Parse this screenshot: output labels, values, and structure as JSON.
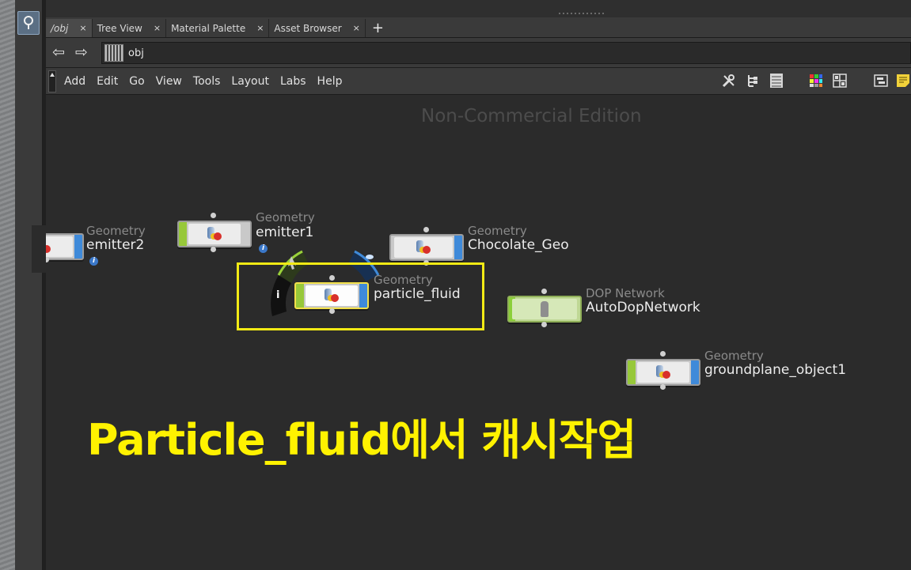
{
  "tabs": [
    {
      "label": "/obj",
      "close": "×",
      "active": true
    },
    {
      "label": "Tree View",
      "close": "×",
      "active": false
    },
    {
      "label": "Material Palette",
      "close": "×",
      "active": false
    },
    {
      "label": "Asset Browser",
      "close": "×",
      "active": false
    }
  ],
  "tab_add": "+",
  "nav": {
    "back": "⇦",
    "forward": "⇨"
  },
  "path": {
    "text": "obj"
  },
  "menu": [
    "Add",
    "Edit",
    "Go",
    "View",
    "Tools",
    "Layout",
    "Labs",
    "Help"
  ],
  "toolbar_icons": [
    "wrench-icon",
    "tree-icon",
    "list-icon",
    "color-grid-icon",
    "grid-layout-icon",
    "network-box-icon",
    "sticky-note-icon"
  ],
  "watermark": "Non-Commercial Edition",
  "nodes": {
    "emitter2": {
      "type": "Geometry",
      "name": "emitter2"
    },
    "emitter1": {
      "type": "Geometry",
      "name": "emitter1"
    },
    "chocolate": {
      "type": "Geometry",
      "name": "Chocolate_Geo"
    },
    "particle": {
      "type": "Geometry",
      "name": "particle_fluid",
      "ring_info": "i"
    },
    "dop": {
      "type": "DOP Network",
      "name": "AutoDopNetwork"
    },
    "ground": {
      "type": "Geometry",
      "name": "groundplane_object1"
    }
  },
  "info_badge": "i",
  "caption": "Particle_fluid에서 캐시작업",
  "colors": {
    "caption": "#fff200",
    "highlight": "#f2ea15",
    "display_flag": "#3f8ad9",
    "bypass_flag": "#97c83a"
  }
}
